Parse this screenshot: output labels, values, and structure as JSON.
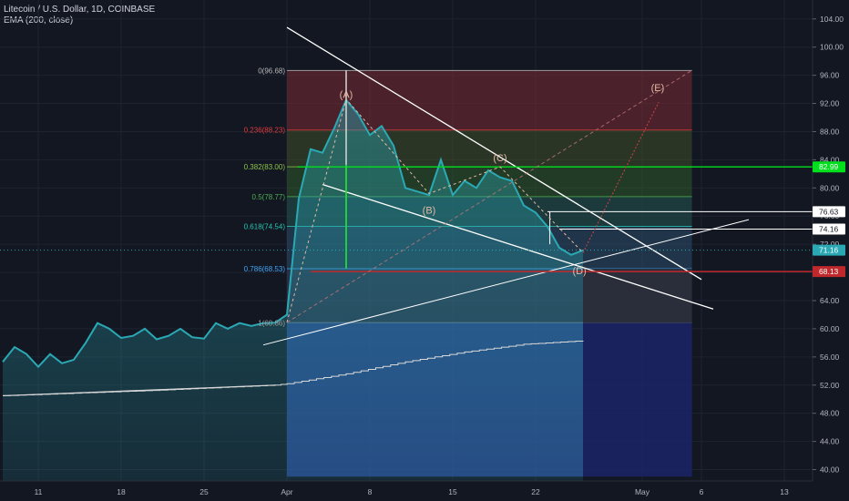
{
  "header": {
    "title": "Litecoin / U.S. Dollar, 1D, COINBASE",
    "indicator": "EMA (200, close)"
  },
  "colors": {
    "background": "#131722",
    "price_line": "#2aa9b5",
    "ema_line": "#d8d8d8",
    "green_line": "#00e01d",
    "red_line": "#c0292c",
    "trend_line": "#ffffff",
    "projection": "#d14242"
  },
  "chart_data": {
    "type": "area",
    "title": "Litecoin / U.S. Dollar, 1D, COINBASE",
    "xlabel": "",
    "ylabel": "",
    "ylim": [
      38,
      106
    ],
    "grid": true,
    "y_ticks": [
      "104.00",
      "100.00",
      "96.00",
      "92.00",
      "88.00",
      "84.00",
      "80.00",
      "76.00",
      "72.00",
      "68.00",
      "64.00",
      "60.00",
      "56.00",
      "52.00",
      "48.00",
      "44.00",
      "40.00"
    ],
    "x_ticks": [
      {
        "label": "11",
        "day": -21
      },
      {
        "label": "18",
        "day": -14
      },
      {
        "label": "25",
        "day": -7
      },
      {
        "label": "Apr",
        "day": 0
      },
      {
        "label": "8",
        "day": 7
      },
      {
        "label": "15",
        "day": 14
      },
      {
        "label": "22",
        "day": 21
      },
      {
        "label": "May",
        "day": 30
      },
      {
        "label": "6",
        "day": 35
      },
      {
        "label": "13",
        "day": 42
      }
    ],
    "series": [
      {
        "name": "LTCUSD",
        "x_units": "days from Apr 1",
        "points": [
          [
            -24,
            55.3
          ],
          [
            -23,
            57.4
          ],
          [
            -22,
            56.4
          ],
          [
            -21,
            54.6
          ],
          [
            -20,
            56.4
          ],
          [
            -19,
            55.1
          ],
          [
            -18,
            55.6
          ],
          [
            -17,
            58.0
          ],
          [
            -16,
            60.8
          ],
          [
            -15,
            60.0
          ],
          [
            -14,
            58.7
          ],
          [
            -13,
            59.0
          ],
          [
            -12,
            60.0
          ],
          [
            -11,
            58.5
          ],
          [
            -10,
            59.0
          ],
          [
            -9,
            60.0
          ],
          [
            -8,
            58.8
          ],
          [
            -7,
            58.6
          ],
          [
            -6,
            60.8
          ],
          [
            -5,
            60.0
          ],
          [
            -4,
            60.8
          ],
          [
            -3,
            60.4
          ],
          [
            -2,
            60.8
          ],
          [
            -1,
            60.86
          ],
          [
            0,
            62.0
          ],
          [
            1,
            78.5
          ],
          [
            2,
            85.5
          ],
          [
            3,
            85.0
          ],
          [
            4,
            88.5
          ],
          [
            5,
            92.5
          ],
          [
            6,
            90.5
          ],
          [
            7,
            87.5
          ],
          [
            8,
            88.8
          ],
          [
            9,
            86.0
          ],
          [
            10,
            80.0
          ],
          [
            11,
            79.5
          ],
          [
            12,
            79.0
          ],
          [
            13,
            84.0
          ],
          [
            14,
            79.0
          ],
          [
            15,
            81.0
          ],
          [
            16,
            80.0
          ],
          [
            17,
            82.5
          ],
          [
            18,
            81.5
          ],
          [
            19,
            81.0
          ],
          [
            20,
            77.5
          ],
          [
            21,
            76.5
          ],
          [
            22,
            74.5
          ],
          [
            23,
            71.5
          ],
          [
            24,
            70.5
          ],
          [
            25,
            71.16
          ]
        ]
      },
      {
        "name": "EMA (200, close)",
        "x_units": "days from Apr 1",
        "points": [
          [
            -24,
            50.5
          ],
          [
            -12,
            51.2
          ],
          [
            -1,
            52.0
          ],
          [
            0,
            52.2
          ],
          [
            5,
            53.6
          ],
          [
            10,
            55.3
          ],
          [
            15,
            56.7
          ],
          [
            20,
            57.8
          ],
          [
            25,
            58.3
          ]
        ]
      }
    ],
    "fibonacci": [
      {
        "label": "0(96.68)",
        "value": 96.68,
        "color": "#b8b8b8"
      },
      {
        "label": "0.236(88.23)",
        "value": 88.23,
        "color": "#e03b3b"
      },
      {
        "label": "0.382(83.00)",
        "value": 83.0,
        "color": "#8bc34a"
      },
      {
        "label": "0.5(78.77)",
        "value": 78.77,
        "color": "#4caf50"
      },
      {
        "label": "0.618(74.54)",
        "value": 74.54,
        "color": "#26c6b0"
      },
      {
        "label": "0.786(68.53)",
        "value": 68.53,
        "color": "#42a5f5"
      },
      {
        "label": "1(60.86)",
        "value": 60.86,
        "color": "#9e9e9e"
      }
    ],
    "wave_labels": [
      "(A)",
      "(B)",
      "(C)",
      "(D)",
      "(E)"
    ],
    "price_tags": [
      {
        "label": "82.99",
        "value": 82.99,
        "bg": "#00e01d",
        "fg": "#ffffff"
      },
      {
        "label": "76.63",
        "value": 76.63,
        "bg": "#ffffff",
        "fg": "#131722"
      },
      {
        "label": "74.16",
        "value": 74.16,
        "bg": "#ffffff",
        "fg": "#131722"
      },
      {
        "label": "71.16",
        "value": 71.16,
        "bg": "#2aa9b5",
        "fg": "#ffffff"
      },
      {
        "label": "68.13",
        "value": 68.13,
        "bg": "#c0292c",
        "fg": "#ffffff"
      }
    ]
  }
}
